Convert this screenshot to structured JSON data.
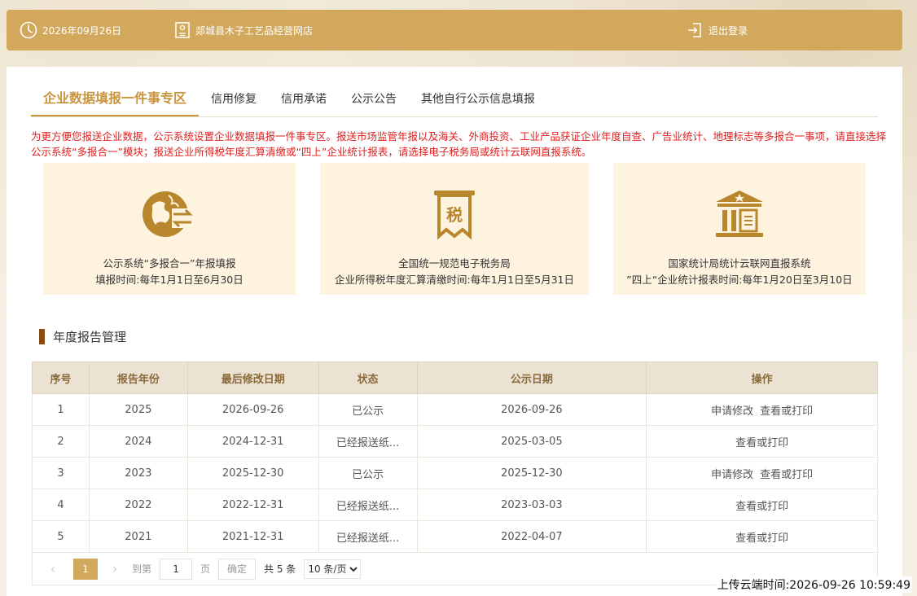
{
  "header": {
    "date": "2026年09月26日",
    "shop_name": "郯城县木子工艺品经营网店",
    "logout_label": "退出登录"
  },
  "tabs": [
    {
      "label": "企业数据填报一件事专区",
      "active": true
    },
    {
      "label": "信用修复"
    },
    {
      "label": "信用承诺"
    },
    {
      "label": "公示公告"
    },
    {
      "label": "其他自行公示信息填报"
    }
  ],
  "notice": "为更方便您报送企业数据，公示系统设置企业数据填报一件事专区。报送市场监管年报以及海关、外商投资、工业产品获证企业年度自查、广告业统计、地理标志等多报合一事项，请直接选择公示系统“多报合一”模块；报送企业所得税年度汇算清缴或“四上”企业统计报表，请选择电子税务局或统计云联网直报系统。",
  "cards": [
    {
      "icon": "globe-exchange-icon",
      "line1": "公示系统“多报合一”年报填报",
      "line2": "填报时间:每年1月1日至6月30日"
    },
    {
      "icon": "tax-icon",
      "icon_text": "税",
      "line1": "全国统一规范电子税务局",
      "line2": "企业所得税年度汇算清缴时间:每年1月1日至5月31日"
    },
    {
      "icon": "building-icon",
      "line1": "国家统计局统计云联网直报系统",
      "line2": "”四上“企业统计报表时间:每年1月20日至3月10日"
    }
  ],
  "section_title": "年度报告管理",
  "table": {
    "headers": [
      "序号",
      "报告年份",
      "最后修改日期",
      "状态",
      "公示日期",
      "操作"
    ],
    "rows": [
      {
        "no": "1",
        "year": "2025",
        "modified": "2026-09-26",
        "status": "已公示",
        "publish": "2026-09-26",
        "ops": [
          "申请修改",
          "查看或打印"
        ]
      },
      {
        "no": "2",
        "year": "2024",
        "modified": "2024-12-31",
        "status": "已经报送纸...",
        "publish": "2025-03-05",
        "ops": [
          "查看或打印"
        ]
      },
      {
        "no": "3",
        "year": "2023",
        "modified": "2025-12-30",
        "status": "已公示",
        "publish": "2025-12-30",
        "ops": [
          "申请修改",
          "查看或打印"
        ]
      },
      {
        "no": "4",
        "year": "2022",
        "modified": "2022-12-31",
        "status": "已经报送纸...",
        "publish": "2023-03-03",
        "ops": [
          "查看或打印"
        ]
      },
      {
        "no": "5",
        "year": "2021",
        "modified": "2021-12-31",
        "status": "已经报送纸...",
        "publish": "2022-04-07",
        "ops": [
          "查看或打印"
        ]
      }
    ]
  },
  "pager": {
    "current_page": "1",
    "goto_label": "到第",
    "goto_value": "1",
    "page_unit": "页",
    "confirm_label": "确定",
    "total": "共 5 条",
    "page_size": "10 条/页"
  },
  "upload_time": "上传云端时间:2026-09-26 10:59:49",
  "colors": {
    "header_bg": "#d2a85c",
    "accent": "#c9953e",
    "notice": "#e02020",
    "card_bg": "#fdf3de",
    "section_bar": "#8a4a10"
  }
}
